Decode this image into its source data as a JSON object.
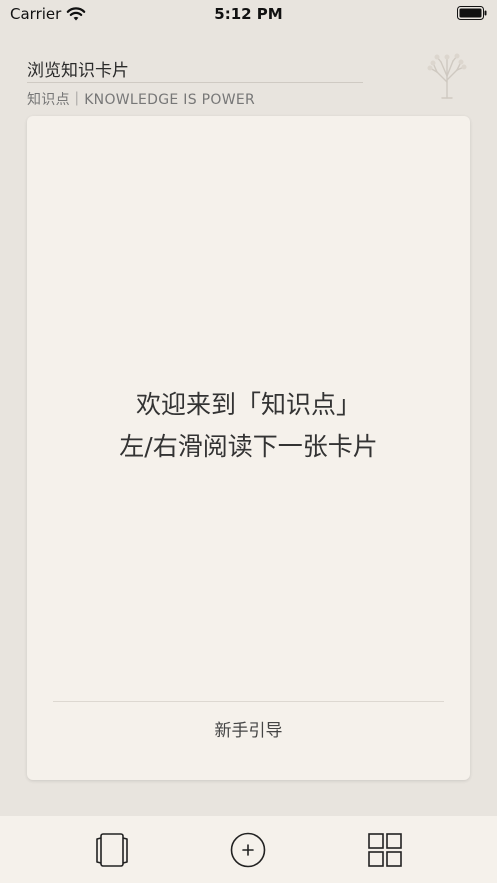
{
  "status_bar": {
    "carrier": "Carrier",
    "time": "5:12 PM"
  },
  "header": {
    "title": "浏览知识卡片",
    "subtitle": "知识点｜KNOWLEDGE IS POWER",
    "logo_icon": "tree-icon"
  },
  "card": {
    "line1": "欢迎来到「知识点」",
    "line2": "左/右滑阅读下一张卡片",
    "guide_label": "新手引导"
  },
  "tab_bar": {
    "items": [
      {
        "icon": "cards-icon"
      },
      {
        "icon": "add-circle-icon"
      },
      {
        "icon": "grid-icon"
      }
    ]
  },
  "colors": {
    "background": "#e8e4de",
    "card": "#f5f1eb",
    "text": "#333333",
    "subtle_text": "#777777"
  }
}
